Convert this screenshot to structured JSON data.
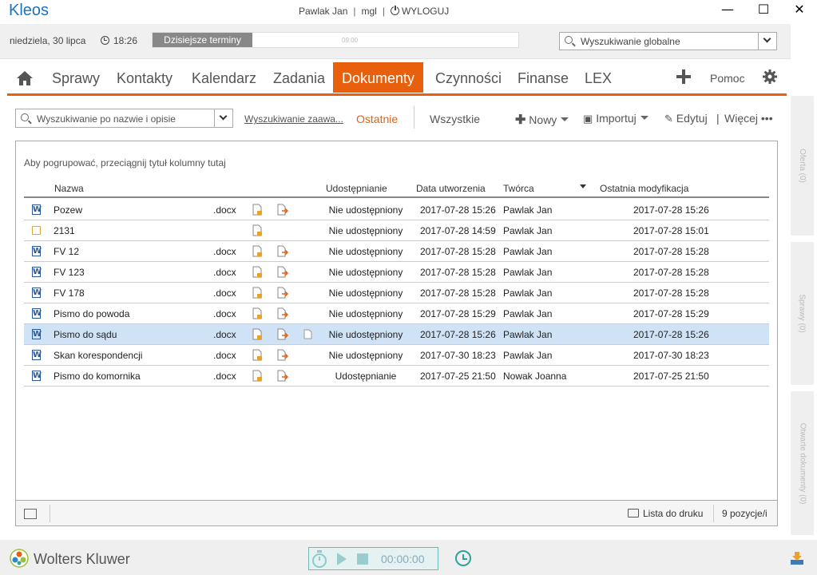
{
  "app": {
    "logo": "Kleos",
    "user": "Pawlak Jan",
    "branch": "mgl",
    "logout": "WYLOGUJ"
  },
  "window": {
    "minimize": "—",
    "maximize": "☐",
    "close": "✕"
  },
  "datebar": {
    "date": "niedziela, 30 lipca",
    "time": "18:26",
    "today_button": "Dzisiejsze terminy",
    "timeline_label": "09:00",
    "global_search_placeholder": "Wyszukiwanie globalne"
  },
  "nav": {
    "items": [
      "Sprawy",
      "Kontakty",
      "Kalendarz",
      "Zadania",
      "Dokumenty",
      "Czynności",
      "Finanse",
      "LEX"
    ],
    "active": "Dokumenty",
    "help": "Pomoc"
  },
  "toolbar": {
    "search_placeholder": "Wyszukiwanie po nazwie i opisie",
    "advanced_search": "Wyszukiwanie zaawa...",
    "tab_recent": "Ostatnie",
    "tab_all": "Wszystkie",
    "new_label": "Nowy",
    "import_label": "Importuj",
    "edit_label": "Edytuj",
    "separator": "|",
    "more_label": "Więcej •••"
  },
  "grid": {
    "group_hint": "Aby pogrupować, przeciągnij tytuł kolumny tutaj",
    "columns": {
      "name": "Nazwa",
      "sharing": "Udostępnianie",
      "created": "Data utworzenia",
      "author": "Twórca",
      "modified": "Ostatnia modyfikacja"
    },
    "rows": [
      {
        "icon": "word-doc-icon",
        "name": "Pozew",
        "ext": ".docx",
        "sharing": "Nie udostępniony",
        "created": "2017-07-28 15:26",
        "author": "Pawlak Jan",
        "modified": "2017-07-28 15:26"
      },
      {
        "icon": "note-icon",
        "name": "2131",
        "ext": "",
        "sharing": "Nie udostępniony",
        "created": "2017-07-28 14:59",
        "author": "Pawlak Jan",
        "modified": "2017-07-28 15:01"
      },
      {
        "icon": "word-doc-icon",
        "name": "FV 12",
        "ext": ".docx",
        "sharing": "Nie udostępniony",
        "created": "2017-07-28 15:28",
        "author": "Pawlak Jan",
        "modified": "2017-07-28 15:28"
      },
      {
        "icon": "word-doc-icon",
        "name": "FV 123",
        "ext": ".docx",
        "sharing": "Nie udostępniony",
        "created": "2017-07-28 15:28",
        "author": "Pawlak Jan",
        "modified": "2017-07-28 15:28"
      },
      {
        "icon": "word-doc-icon",
        "name": "FV 178",
        "ext": ".docx",
        "sharing": "Nie udostępniony",
        "created": "2017-07-28 15:28",
        "author": "Pawlak Jan",
        "modified": "2017-07-28 15:28"
      },
      {
        "icon": "word-doc-icon",
        "name": "Pismo do powoda",
        "ext": ".docx",
        "sharing": "Nie udostępniony",
        "created": "2017-07-28 15:29",
        "author": "Pawlak Jan",
        "modified": "2017-07-28 15:29"
      },
      {
        "icon": "word-doc-icon",
        "name": "Pismo do sądu",
        "ext": ".docx",
        "sharing": "Nie udostępniony",
        "created": "2017-07-28 15:26",
        "author": "Pawlak Jan",
        "modified": "2017-07-28 15:26",
        "selected": true
      },
      {
        "icon": "word-doc-icon",
        "name": "Skan korespondencji",
        "ext": ".docx",
        "sharing": "Nie udostępniony",
        "created": "2017-07-30 18:23",
        "author": "Pawlak Jan",
        "modified": "2017-07-30 18:23"
      },
      {
        "icon": "word-doc-icon",
        "name": "Pismo do komornika",
        "ext": ".docx",
        "sharing": "Udostępnianie",
        "created": "2017-07-25 21:50",
        "author": "Nowak Joanna",
        "modified": "2017-07-25 21:50"
      }
    ],
    "footer": {
      "print_list": "Lista do druku",
      "count": "9 pozycje/i"
    }
  },
  "side_panels": [
    "Oferta (0)",
    "Sprawy (0)",
    "Otwarte dokumenty (0)"
  ],
  "bottom": {
    "brand": "Wolters Kluwer",
    "timer": "00:00:00"
  },
  "colors": {
    "accent": "#e8600c",
    "brand_blue": "#1a73c1",
    "selected_row": "#cfe2f6",
    "timer_teal": "#2fa39b"
  }
}
